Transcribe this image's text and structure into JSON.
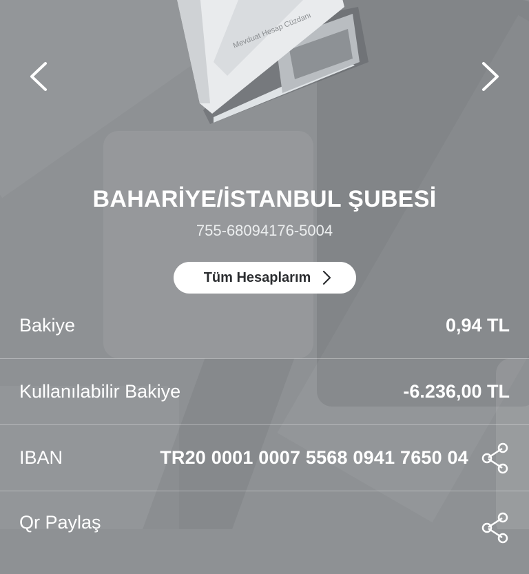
{
  "booklet": {
    "caption": "Mevduat Hesap Cüzdanı"
  },
  "account": {
    "branch": "BAHARİYE/İSTANBUL ŞUBESİ",
    "number": "755-68094176-5004",
    "all_accounts_label": "Tüm Hesaplarım"
  },
  "rows": {
    "balance": {
      "label": "Bakiye",
      "value": "0,94 TL"
    },
    "available": {
      "label": "Kullanılabilir Bakiye",
      "value": "-6.236,00 TL"
    },
    "iban": {
      "label": "IBAN",
      "value": "TR20 0001 0007 5568 0941 7650 04"
    },
    "qr": {
      "label": "Qr Paylaş"
    }
  },
  "icons": {
    "prev": "chevron-left-icon",
    "next": "chevron-right-icon",
    "share": "share-icon",
    "button_chevron": "chevron-right-icon"
  }
}
